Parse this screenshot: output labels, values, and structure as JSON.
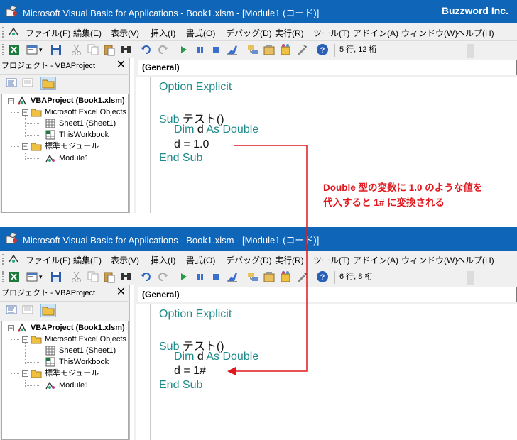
{
  "app": {
    "title": "Microsoft Visual Basic for Applications - Book1.xlsm - [Module1 (コード)]",
    "brand": "Buzzword Inc."
  },
  "menu": [
    "ファイル(F)",
    "編集(E)",
    "表示(V)",
    "挿入(I)",
    "書式(O)",
    "デバッグ(D)",
    "実行(R)",
    "ツール(T)",
    "アドイン(A)",
    "ウィンドウ(W)",
    "ヘルプ(H)"
  ],
  "toolbar_icons": [
    "excel-icon",
    "insert-userform-icon",
    "save-icon",
    "cut-icon",
    "copy-icon",
    "paste-icon",
    "find-icon",
    "undo-icon",
    "redo-icon",
    "run-icon",
    "break-icon",
    "reset-icon",
    "design-mode-icon",
    "project-explorer-icon",
    "properties-icon",
    "object-browser-icon",
    "toolbox-icon",
    "help-icon"
  ],
  "project": {
    "title": "プロジェクト - VBAProject",
    "close": "✕",
    "tree": {
      "root": "VBAProject (Book1.xlsm)",
      "folder1": "Microsoft Excel Objects",
      "sheet": "Sheet1 (Sheet1)",
      "workbook": "ThisWorkbook",
      "folder2": "標準モジュール",
      "module": "Module1"
    }
  },
  "general_combo": "(General)",
  "panels": [
    {
      "status": "5 行, 12 桁",
      "code": {
        "option": "Option Explicit",
        "sub_kw": "Sub",
        "sub_name": " テスト()",
        "dim_kw": "Dim",
        "dim_var": " d ",
        "as_double": "As Double",
        "assign": "d = 1.0",
        "end_sub": "End Sub"
      }
    },
    {
      "status": "6 行, 8 桁",
      "code": {
        "option": "Option Explicit",
        "sub_kw": "Sub",
        "sub_name": " テスト()",
        "dim_kw": "Dim",
        "dim_var": " d ",
        "as_double": "As Double",
        "assign": "d = 1#",
        "end_sub": "End Sub"
      }
    }
  ],
  "annotation": {
    "line1": "Double 型の変数に 1.0 のような値を",
    "line2": "代入すると 1# に変換される"
  },
  "colors": {
    "titlebar": "#0f66b9",
    "keyword": "#1e8a8a",
    "annotation": "#e0191f"
  }
}
